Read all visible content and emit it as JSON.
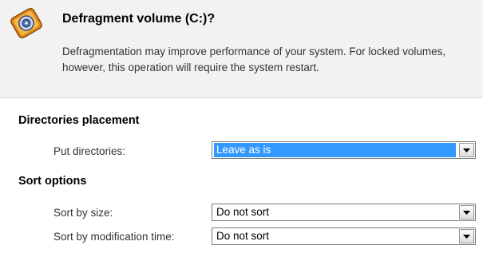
{
  "dialog": {
    "title": "Defragment volume (C:)?",
    "description": "Defragmentation may improve performance of your system. For locked volumes, however, this operation will require the system restart.",
    "icon": "defragment-disk-icon"
  },
  "directories_placement": {
    "heading": "Directories placement",
    "put_directories": {
      "label": "Put directories:",
      "value": "Leave as is"
    }
  },
  "sort_options": {
    "heading": "Sort options",
    "sort_by_size": {
      "label": "Sort by size:",
      "value": "Do not sort"
    },
    "sort_by_modification_time": {
      "label": "Sort by modification time:",
      "value": "Do not sort"
    }
  },
  "colors": {
    "selection": "#3399ff",
    "header_background": "#f2f2f2"
  }
}
